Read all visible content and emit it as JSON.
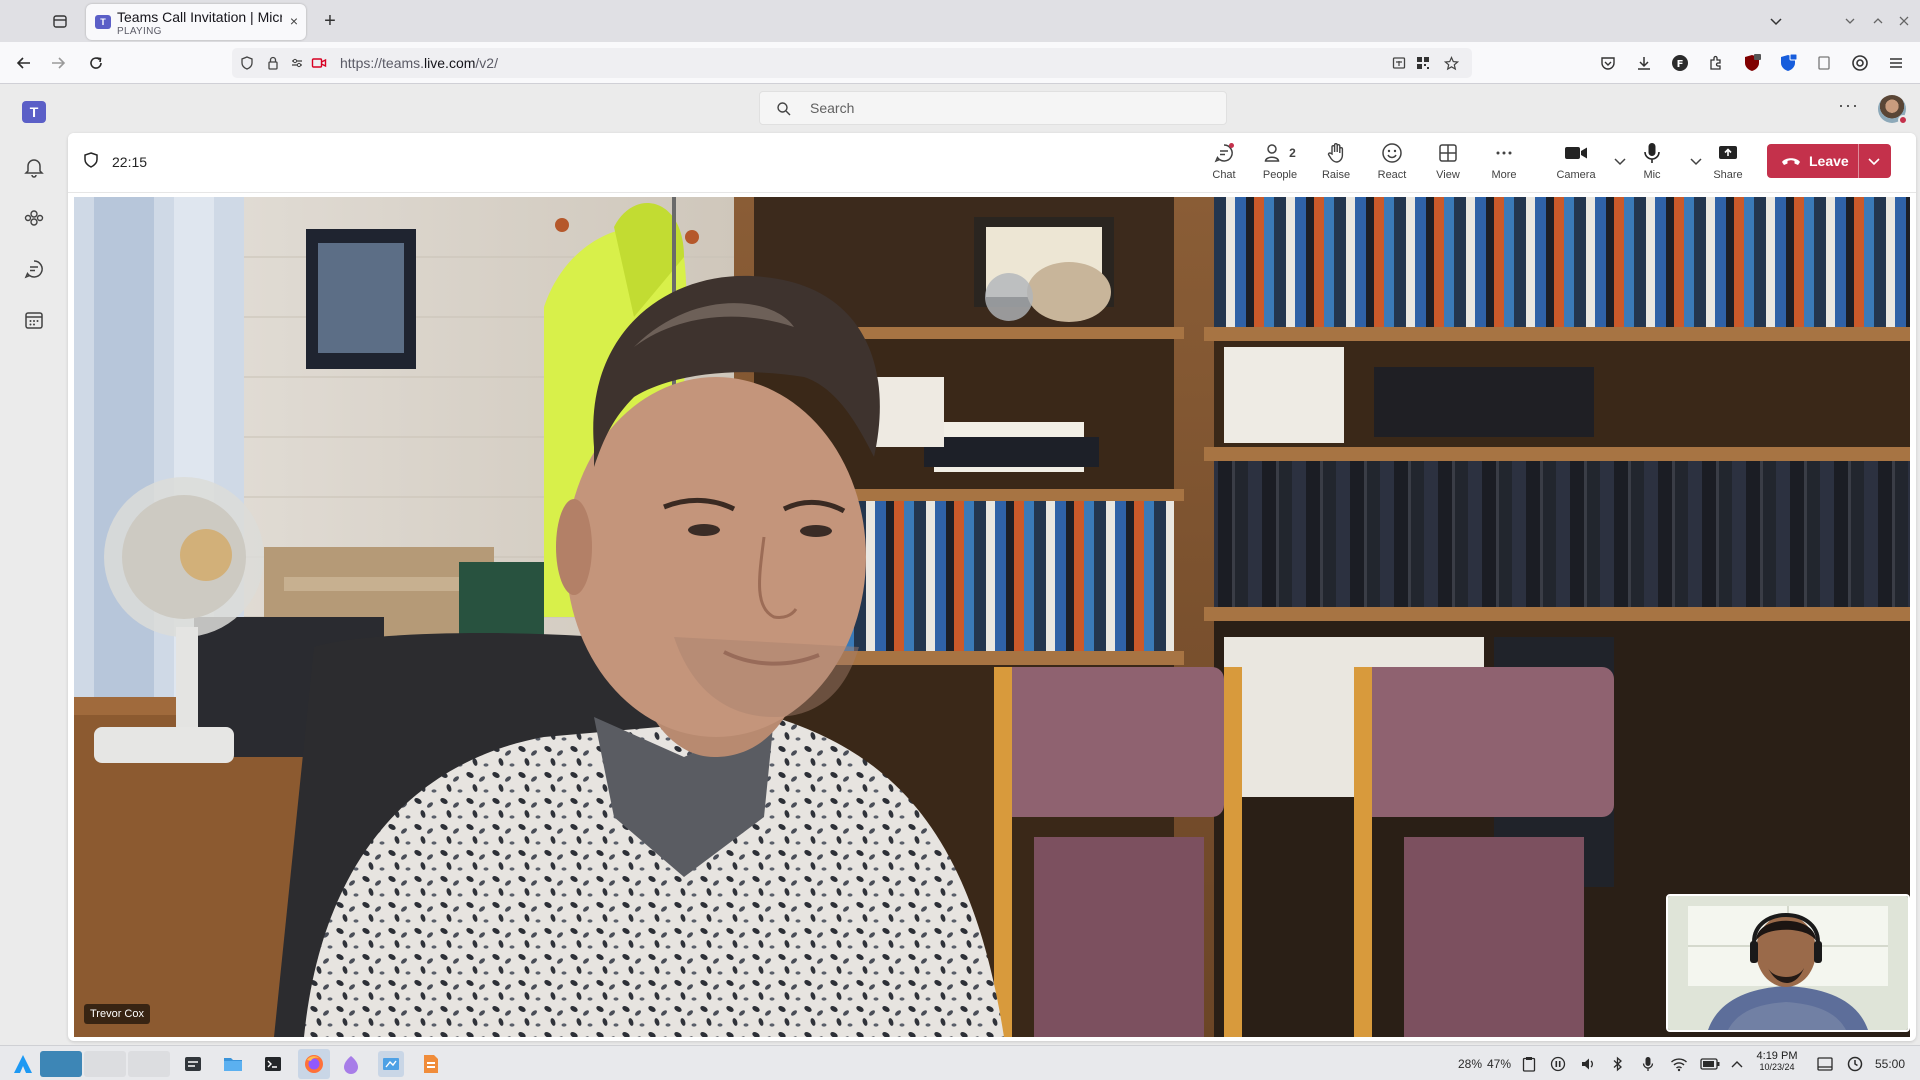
{
  "browser": {
    "tab": {
      "title": "Teams Call Invitation | Microsoft Teams",
      "status": "PLAYING",
      "close": "×"
    },
    "new_tab": "+",
    "url": {
      "prefix": "https://teams.",
      "domain": "live.com",
      "path": "/v2/"
    }
  },
  "teams": {
    "logo": "T",
    "search": {
      "placeholder": "Search"
    },
    "more": "···"
  },
  "meeting": {
    "timer": "22:15",
    "controls": {
      "chat": "Chat",
      "people": "People",
      "people_count": "2",
      "raise": "Raise",
      "react": "React",
      "view": "View",
      "more": "More",
      "camera": "Camera",
      "mic": "Mic",
      "share": "Share",
      "leave": "Leave"
    },
    "participant_name": "Trevor Cox"
  },
  "taskbar": {
    "tray": {
      "cpu": "28%",
      "mem": "47%",
      "battery_time": "55:00"
    },
    "clock": {
      "time": "4:19 PM",
      "date": "10/23/24"
    }
  },
  "colors": {
    "teams_purple": "#5b5fc7",
    "leave_red": "#c4314b"
  }
}
